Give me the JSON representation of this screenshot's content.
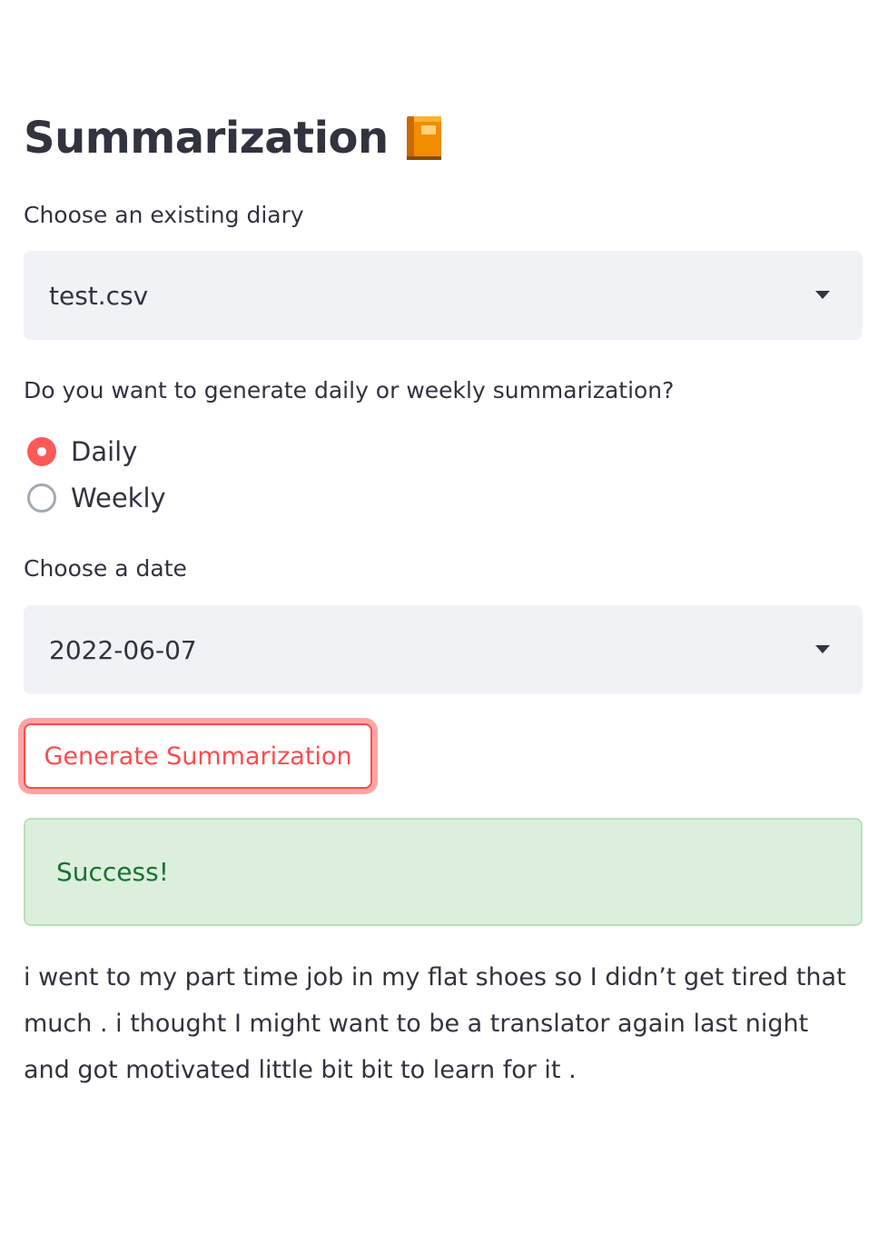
{
  "header": {
    "title": "Summarization",
    "title_icon": "orange-book-icon"
  },
  "diary_select": {
    "label": "Choose an existing diary",
    "value": "test.csv"
  },
  "mode_radio": {
    "label": "Do you want to generate daily or weekly summarization?",
    "options": [
      {
        "label": "Daily",
        "selected": true
      },
      {
        "label": "Weekly",
        "selected": false
      }
    ]
  },
  "date_select": {
    "label": "Choose a date",
    "value": "2022-06-07"
  },
  "actions": {
    "generate_label": "Generate Summarization"
  },
  "status": {
    "message": "Success!"
  },
  "summary": {
    "text": "i went to my part time job in my flat shoes so I didn’t get tired that much . i thought I might want to be a translator again last night and got motivated little bit bit to learn for it ."
  },
  "colors": {
    "accent": "#ff4b4b",
    "text": "#31333f",
    "input_bg": "#f0f2f6",
    "success_bg": "#dcefdc",
    "success_text": "#177233"
  }
}
